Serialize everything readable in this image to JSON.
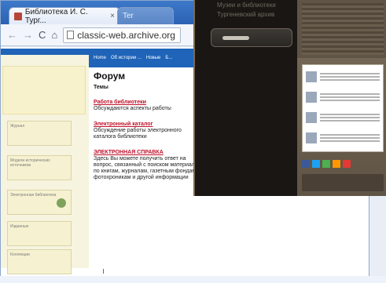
{
  "browser": {
    "tab_active_title": "Библиотека И. С. Тург...",
    "tab_active_close": "×",
    "tab_inactive_title": "Ter",
    "back_icon": "←",
    "forward_icon": "→",
    "reload_icon": "C",
    "home_icon": "⌂",
    "address": "classic-web.archive.org"
  },
  "site": {
    "nav": [
      "Home",
      "Об истории ...",
      "Новые",
      "Б..."
    ],
    "forum": {
      "title": "Форум",
      "subtitle": "Темы",
      "topics": [
        {
          "link": "Работа библиотеки",
          "desc": "Обсуждаются аспекты работы"
        },
        {
          "link": "Электронный каталог",
          "desc": "Обсуждение работы электронного каталога библиотеки"
        },
        {
          "link": "ЭЛЕКТРОННАЯ СПРАВКА",
          "desc": "Здесь Вы можете получить ответ на вопрос, связанный с поиском материала по книгам, журналам, газетным фондам, фотохроникам и другой информации"
        }
      ]
    },
    "left_boxes": [
      "Журнал",
      "Модели исторических источников",
      "Электронная библиотека",
      "Изданные",
      "Коллекции"
    ]
  },
  "overlay": {
    "title_line1": "Музеи и библиотеки",
    "title_line2": "Тургеневский архив"
  },
  "colors": {
    "nav_blue": "#1f64b8",
    "link_red": "#c0122b",
    "overlay_bg": "#1a1614",
    "panel_beige": "#f6f4de"
  }
}
